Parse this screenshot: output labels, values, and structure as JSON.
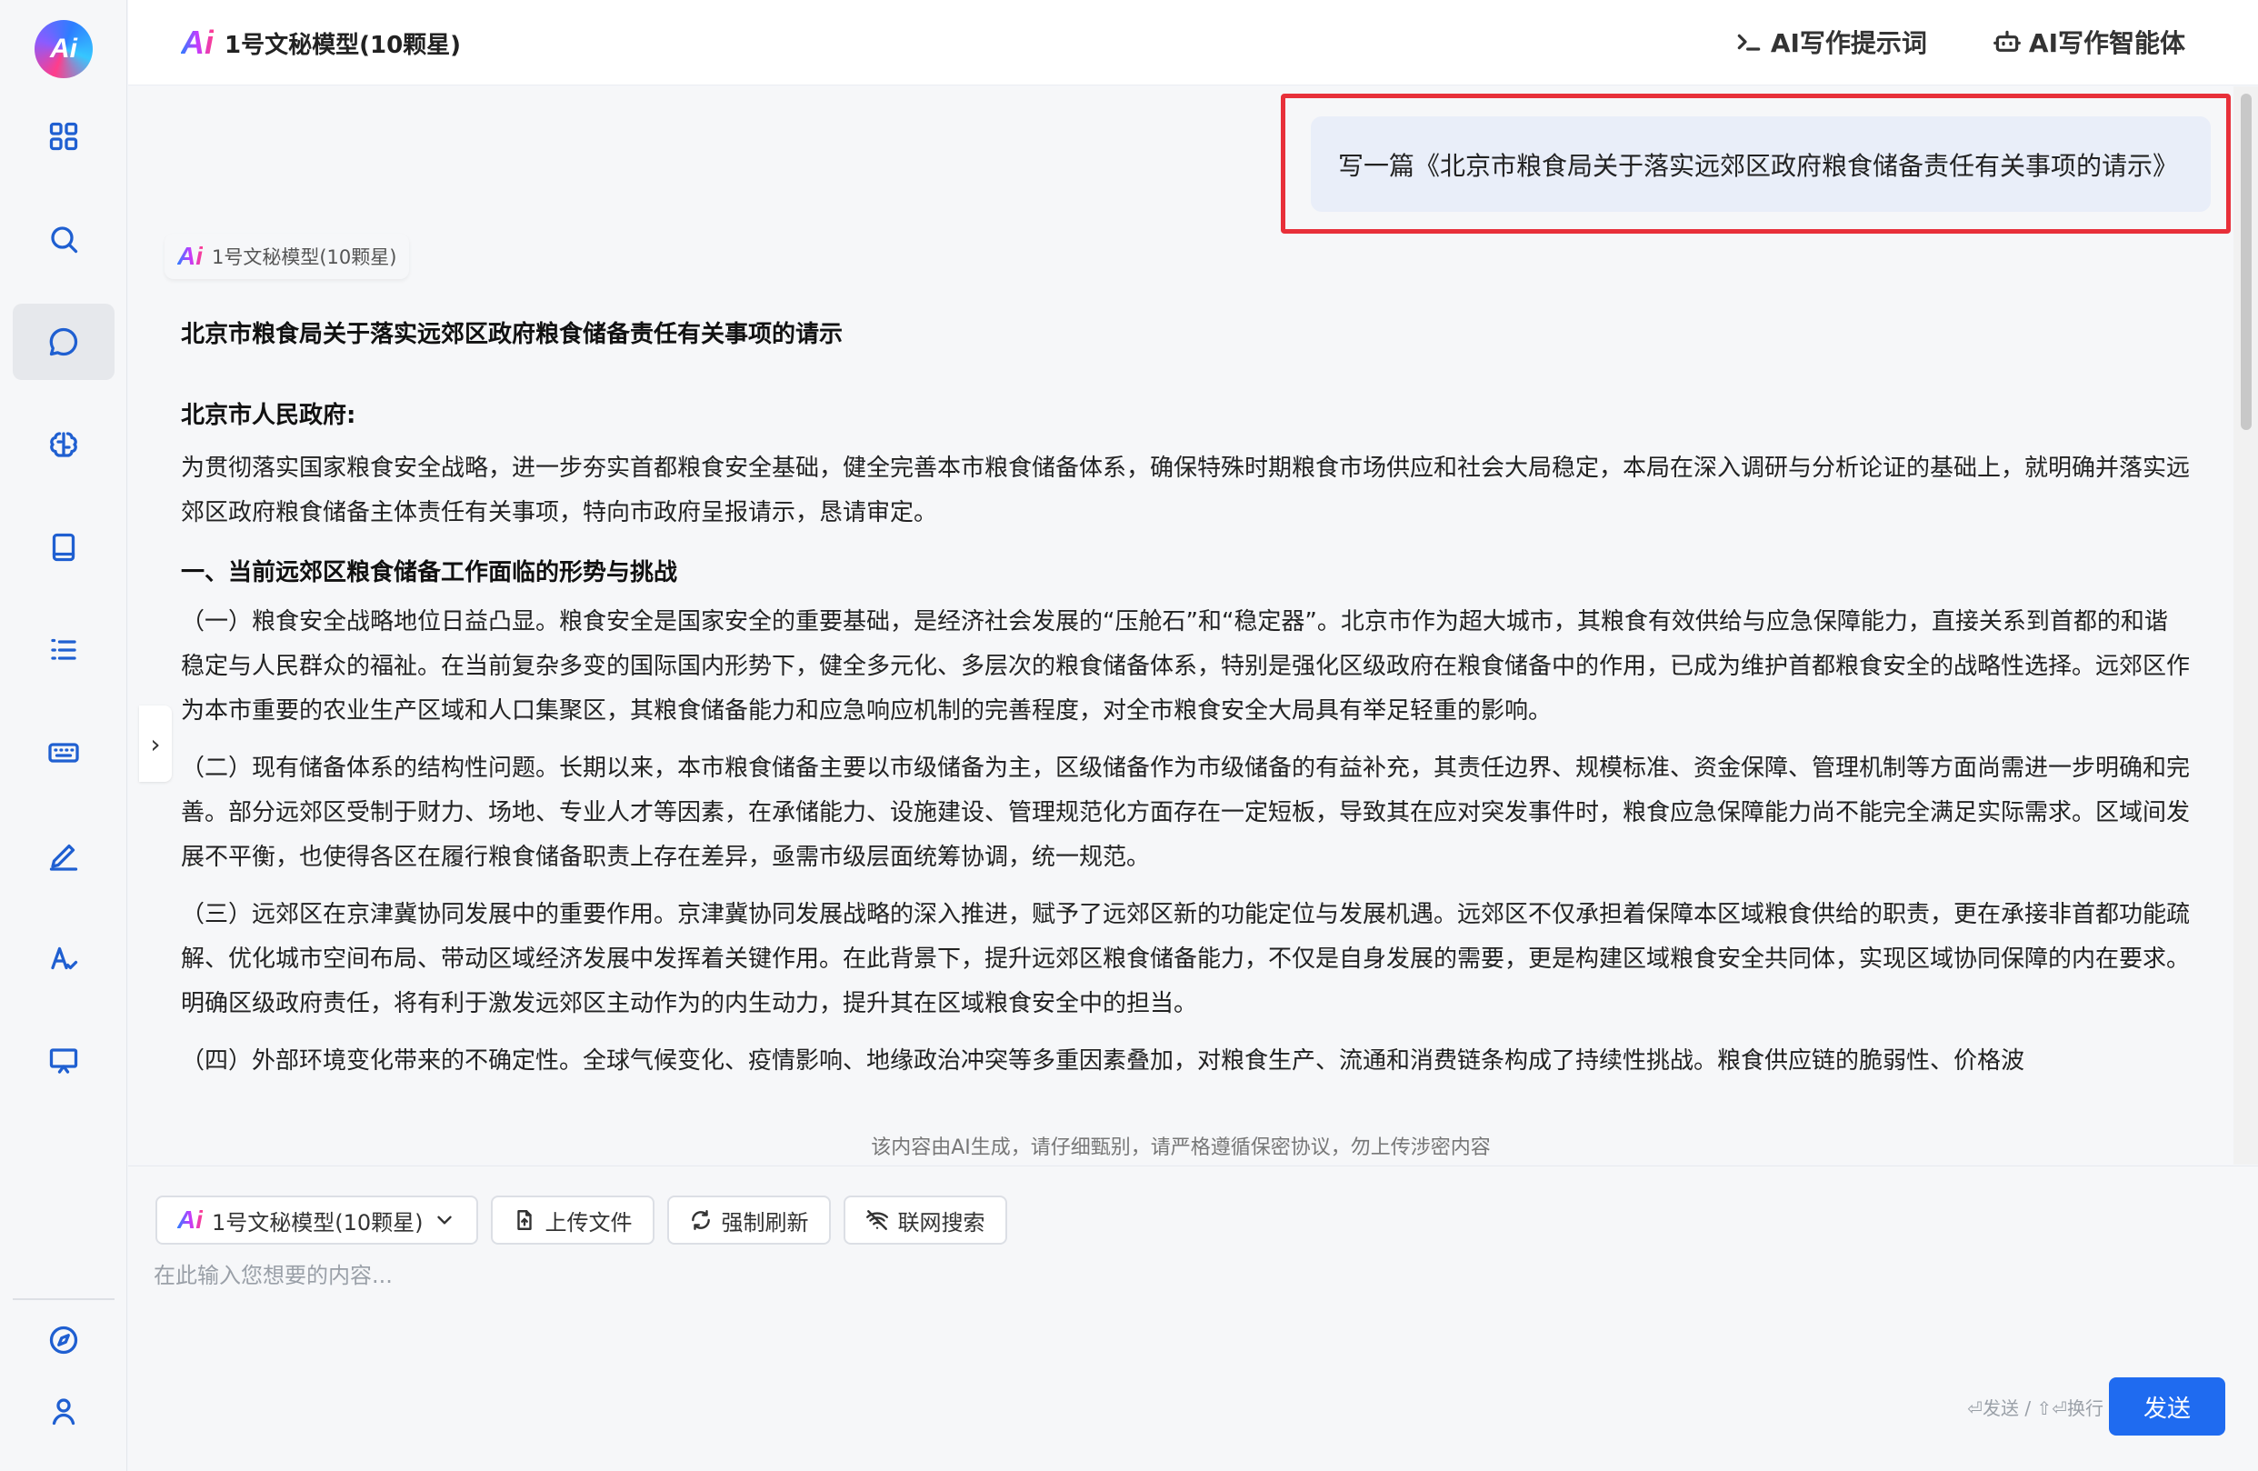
{
  "sidebar": {
    "logo_text": "Ai",
    "items": [
      {
        "name": "apps-grid-icon"
      },
      {
        "name": "search-icon"
      },
      {
        "name": "chat-icon",
        "active": true
      },
      {
        "name": "brain-icon"
      },
      {
        "name": "book-icon"
      },
      {
        "name": "list-icon"
      },
      {
        "name": "keyboard-icon"
      },
      {
        "name": "pen-icon"
      },
      {
        "name": "translate-icon"
      },
      {
        "name": "presentation-icon"
      }
    ],
    "bottom_items": [
      {
        "name": "compass-icon"
      },
      {
        "name": "user-icon"
      }
    ]
  },
  "header": {
    "ai_mark": "Ai",
    "model_title": "1号文秘模型(10颗星)",
    "links": [
      {
        "label": "AI写作提示词",
        "icon": "terminal-icon"
      },
      {
        "label": "AI写作智能体",
        "icon": "robot-icon"
      }
    ]
  },
  "chat": {
    "user_message": "写一篇《北京市粮食局关于落实远郊区政府粮食储备责任有关事项的请示》",
    "bot_ai_mark": "Ai",
    "bot_name": "1号文秘模型(10颗星)",
    "answer": {
      "title": "北京市粮食局关于落实远郊区政府粮食储备责任有关事项的请示",
      "salutation": "北京市人民政府:",
      "intro": "为贯彻落实国家粮食安全战略，进一步夯实首都粮食安全基础，健全完善本市粮食储备体系，确保特殊时期粮食市场供应和社会大局稳定，本局在深入调研与分析论证的基础上，就明确并落实远郊区政府粮食储备主体责任有关事项，特向市政府呈报请示，恳请审定。",
      "section1_title": "一、当前远郊区粮食储备工作面临的形势与挑战",
      "paragraphs": [
        "（一）粮食安全战略地位日益凸显。粮食安全是国家安全的重要基础，是经济社会发展的“压舱石”和“稳定器”。北京市作为超大城市，其粮食有效供给与应急保障能力，直接关系到首都的和谐稳定与人民群众的福祉。在当前复杂多变的国际国内形势下，健全多元化、多层次的粮食储备体系，特别是强化区级政府在粮食储备中的作用，已成为维护首都粮食安全的战略性选择。远郊区作为本市重要的农业生产区域和人口集聚区，其粮食储备能力和应急响应机制的完善程度，对全市粮食安全大局具有举足轻重的影响。",
        "（二）现有储备体系的结构性问题。长期以来，本市粮食储备主要以市级储备为主，区级储备作为市级储备的有益补充，其责任边界、规模标准、资金保障、管理机制等方面尚需进一步明确和完善。部分远郊区受制于财力、场地、专业人才等因素，在承储能力、设施建设、管理规范化方面存在一定短板，导致其在应对突发事件时，粮食应急保障能力尚不能完全满足实际需求。区域间发展不平衡，也使得各区在履行粮食储备职责上存在差异，亟需市级层面统筹协调，统一规范。",
        "（三）远郊区在京津冀协同发展中的重要作用。京津冀协同发展战略的深入推进，赋予了远郊区新的功能定位与发展机遇。远郊区不仅承担着保障本区域粮食供给的职责，更在承接非首都功能疏解、优化城市空间布局、带动区域经济发展中发挥着关键作用。在此背景下，提升远郊区粮食储备能力，不仅是自身发展的需要，更是构建区域粮食安全共同体，实现区域协同保障的内在要求。明确区级政府责任，将有利于激发远郊区主动作为的内生动力，提升其在区域粮食安全中的担当。",
        "（四）外部环境变化带来的不确定性。全球气候变化、疫情影响、地缘政治冲突等多重因素叠加，对粮食生产、流通和消费链条构成了持续性挑战。粮食供应链的脆弱性、价格波"
      ]
    },
    "expand_glyph": "›"
  },
  "disclaimer": "该内容由AI生成，请仔细甄别，请严格遵循保密协议，勿上传涉密内容",
  "composer": {
    "model_select": {
      "ai_mark": "Ai",
      "label": "1号文秘模型(10颗星)"
    },
    "buttons": [
      {
        "label": "上传文件",
        "icon": "upload-file-icon"
      },
      {
        "label": "强制刷新",
        "icon": "refresh-icon"
      },
      {
        "label": "联网搜索",
        "icon": "wifi-off-icon"
      }
    ],
    "input_placeholder": "在此输入您想要的内容...",
    "hint": "⏎发送 / ⇧⏎换行",
    "send_label": "发送"
  },
  "colors": {
    "accent": "#1f6bf0",
    "highlight_border": "#e8303a",
    "user_bubble": "#e9eef9"
  }
}
